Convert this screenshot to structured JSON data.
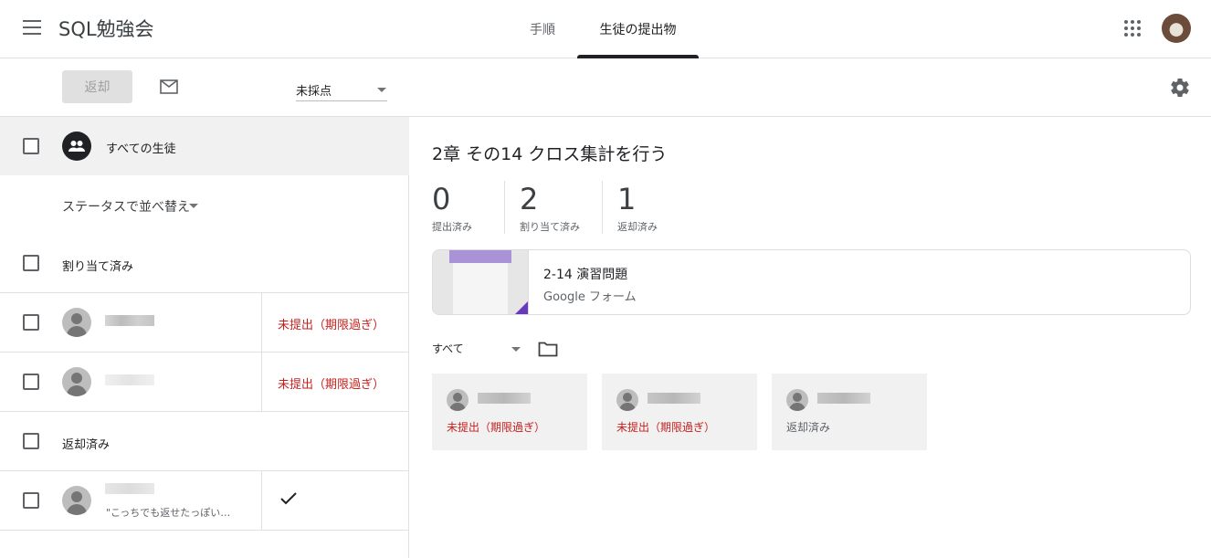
{
  "header": {
    "app_title": "SQL勉強会",
    "tabs": [
      {
        "label": "手順",
        "active": false
      },
      {
        "label": "生徒の提出物",
        "active": true
      }
    ],
    "menu_icon": "hamburger-menu-icon",
    "apps_icon": "apps-grid-icon",
    "avatar_icon": "account-avatar"
  },
  "toolbar": {
    "return_label": "返却",
    "mail_icon": "mail-icon",
    "filter_value": "未採点",
    "settings_icon": "gear-icon"
  },
  "left": {
    "all_students_label": "すべての生徒",
    "sort_label": "ステータスで並べ替え",
    "sections": [
      {
        "label": "割り当て済み",
        "students": [
          {
            "status": "未提出（期限過ぎ）"
          },
          {
            "status": "未提出（期限過ぎ）"
          }
        ]
      },
      {
        "label": "返却済み",
        "students": [
          {
            "comment": "\"こっちでも返せたっぽい…",
            "status_icon": "check-icon"
          }
        ]
      }
    ]
  },
  "right": {
    "assignment_title": "2章 その14 クロス集計を行う",
    "stats": [
      {
        "value": "0",
        "label": "提出済み"
      },
      {
        "value": "2",
        "label": "割り当て済み"
      },
      {
        "value": "1",
        "label": "返却済み"
      }
    ],
    "attachment": {
      "title": "2-14 演習問題",
      "subtitle": "Google フォーム"
    },
    "filter_value": "すべて",
    "folder_icon": "folder-icon",
    "cards": [
      {
        "status": "未提出（期限過ぎ）",
        "color": "#c5221f"
      },
      {
        "status": "未提出（期限過ぎ）",
        "color": "#c5221f"
      },
      {
        "status": "返却済み",
        "color": "#5f6368"
      }
    ]
  },
  "colors": {
    "accent": "#202124",
    "late": "#c5221f",
    "form_purple": "#673ab7"
  }
}
